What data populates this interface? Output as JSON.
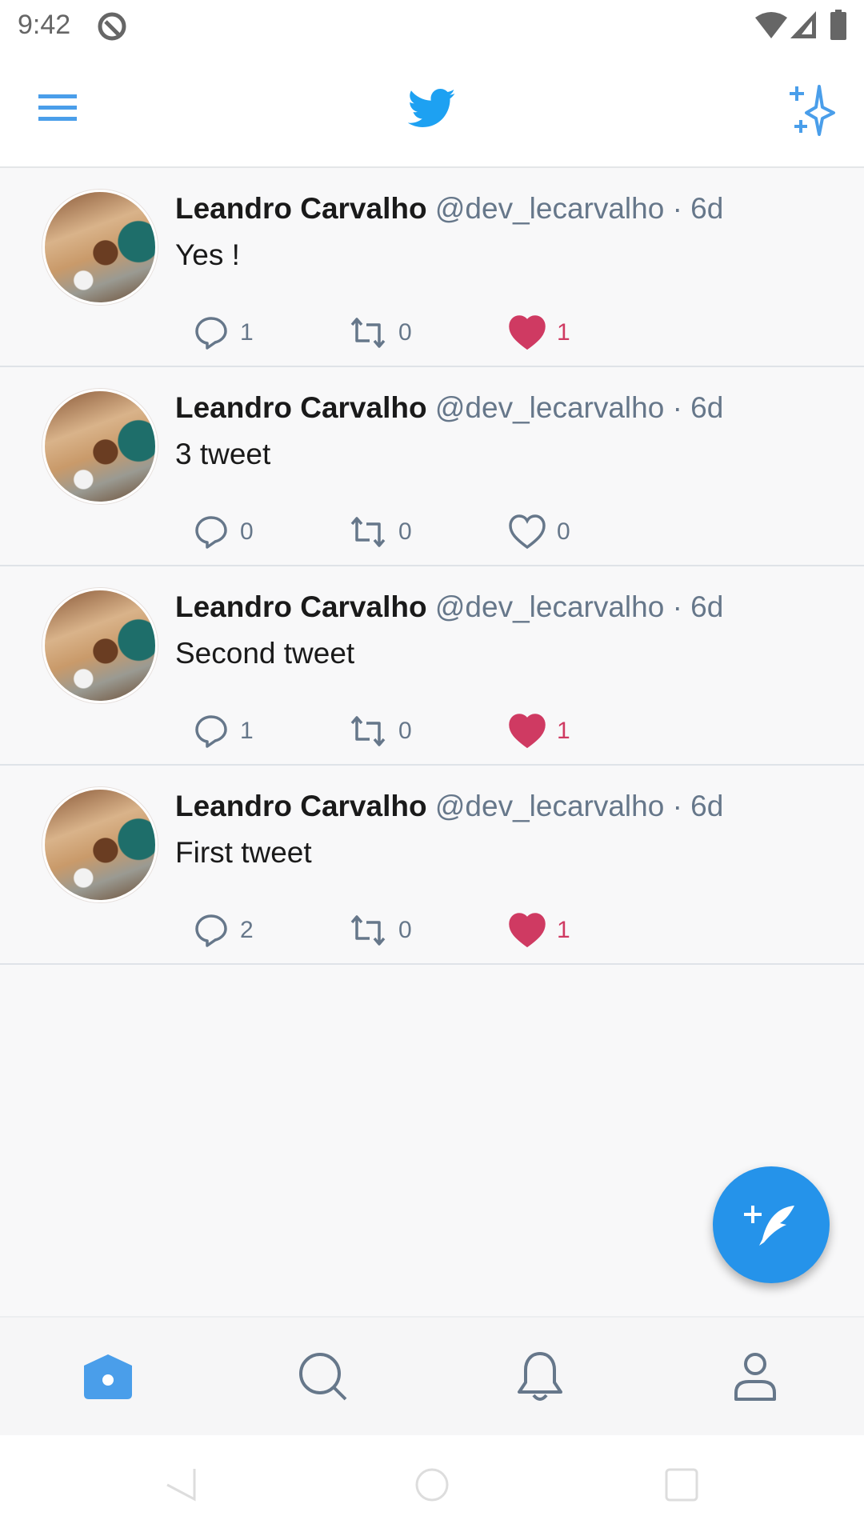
{
  "status_bar": {
    "time": "9:42",
    "icons": [
      "do-not-disturb-icon",
      "wifi-icon",
      "signal-icon",
      "battery-icon"
    ]
  },
  "header": {
    "icons": [
      "menu-icon",
      "twitter-bird-logo",
      "sparkle-icon"
    ]
  },
  "colors": {
    "accent": "#2593ea",
    "logo": "#1da1f2",
    "like": "#cf3a62",
    "muted": "#66778a"
  },
  "tweets": [
    {
      "name": "Leandro Carvalho",
      "handle": "@dev_lecarvalho · 6d",
      "text": "Yes !",
      "replies": "1",
      "retweets": "0",
      "likes": "1",
      "liked": true
    },
    {
      "name": "Leandro Carvalho",
      "handle": "@dev_lecarvalho · 6d",
      "text": "3 tweet",
      "replies": "0",
      "retweets": "0",
      "likes": "0",
      "liked": false
    },
    {
      "name": "Leandro Carvalho",
      "handle": "@dev_lecarvalho · 6d",
      "text": "Second tweet",
      "replies": "1",
      "retweets": "0",
      "likes": "1",
      "liked": true
    },
    {
      "name": "Leandro Carvalho",
      "handle": "@dev_lecarvalho · 6d",
      "text": "First tweet",
      "replies": "2",
      "retweets": "0",
      "likes": "1",
      "liked": true
    }
  ],
  "fab": {
    "icon": "compose-tweet-icon"
  },
  "bottom_nav": {
    "items": [
      "home",
      "search",
      "notifications",
      "profile"
    ],
    "active": "home"
  }
}
